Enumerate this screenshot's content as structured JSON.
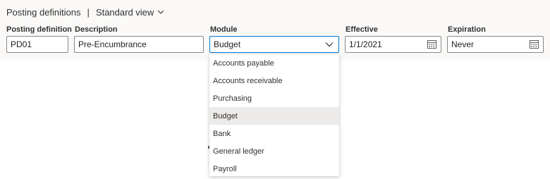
{
  "header": {
    "title": "Posting definitions",
    "separator": "|",
    "view_label": "Standard view"
  },
  "fields": {
    "posting_definition": {
      "label": "Posting definition",
      "value": "PD01"
    },
    "description": {
      "label": "Description",
      "value": "Pre-Encumbrance"
    },
    "module": {
      "label": "Module",
      "value": "Budget"
    },
    "effective": {
      "label": "Effective",
      "value": "1/1/2021"
    },
    "expiration": {
      "label": "Expiration",
      "value": "Never"
    }
  },
  "module_options": [
    {
      "label": "Accounts payable"
    },
    {
      "label": "Accounts receivable"
    },
    {
      "label": "Purchasing"
    },
    {
      "label": "Budget",
      "selected": true
    },
    {
      "label": "Bank"
    },
    {
      "label": "General ledger"
    },
    {
      "label": "Payroll"
    }
  ],
  "colors": {
    "accent": "#0078d4",
    "selected_bg": "#edebe9",
    "header_bg": "#faf9f8"
  },
  "icons": {
    "view_chevron": "chevron-down-icon",
    "module_chevron": "chevron-down-icon",
    "date_picker": "calendar-icon"
  }
}
